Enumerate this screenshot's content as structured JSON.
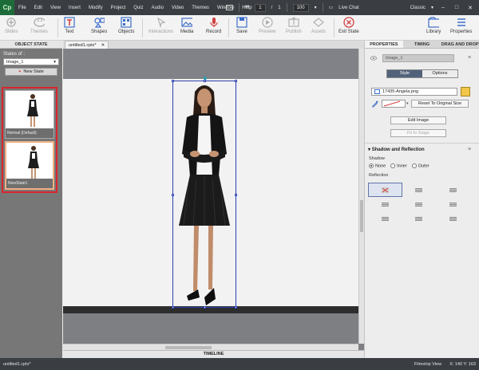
{
  "app": {
    "logo": "Cp"
  },
  "menu": [
    "File",
    "Edit",
    "View",
    "Insert",
    "Modify",
    "Project",
    "Quiz",
    "Audio",
    "Video",
    "Themes",
    "Window",
    "Help"
  ],
  "menubar_right": {
    "page_current": "1",
    "page_sep": "/",
    "page_total": "1",
    "zoom": "100",
    "live_chat": "Live Chat",
    "workspace": "Classic",
    "minimize": "–",
    "maximize": "□",
    "close": "✕"
  },
  "toolbar": {
    "slides": "Slides",
    "themes": "Themes",
    "text": "Text",
    "shapes": "Shapes",
    "objects": "Objects",
    "interactions": "Interactions",
    "media": "Media",
    "record": "Record",
    "save": "Save",
    "preview": "Preview",
    "publish": "Publish",
    "assets": "Assets",
    "exit_state": "Exit State",
    "library": "Library",
    "properties": "Properties"
  },
  "left_panel": {
    "tab": "OBJECT STATE",
    "states_of": "States of :",
    "selected_object": "Image_1",
    "new_state": "New State",
    "states": [
      {
        "label": "Normal (Default)"
      },
      {
        "label": "NewState1"
      }
    ]
  },
  "document": {
    "tab_name": "untitled1.cptx*",
    "tab_close": "✕"
  },
  "timeline": {
    "label": "TIMELINE"
  },
  "properties": {
    "tabs": [
      "PROPERTIES",
      "TIMING",
      "DRAG AND DROP"
    ],
    "object_name": "Image_1",
    "seg_style": "Style",
    "seg_options": "Options",
    "image_file": "17435-Angela.png",
    "reset_size": "Reset To Original Size",
    "edit_image": "Edit Image",
    "fit_to_stage": "Fit to Stage",
    "section_title": "Shadow and Reflection",
    "shadow_label": "Shadow",
    "shadow_options": [
      "None",
      "Inner",
      "Outer"
    ],
    "shadow_selected": "None",
    "reflection_label": "Reflection"
  },
  "statusbar": {
    "file": "untitled1.cptx*",
    "view": "Filmstrip View",
    "coords": "X: 140 Y: 163"
  },
  "colors": {
    "accent_red": "#d9262c",
    "selection_blue": "#2a3fb0",
    "dark_chrome": "#3a3d42"
  }
}
